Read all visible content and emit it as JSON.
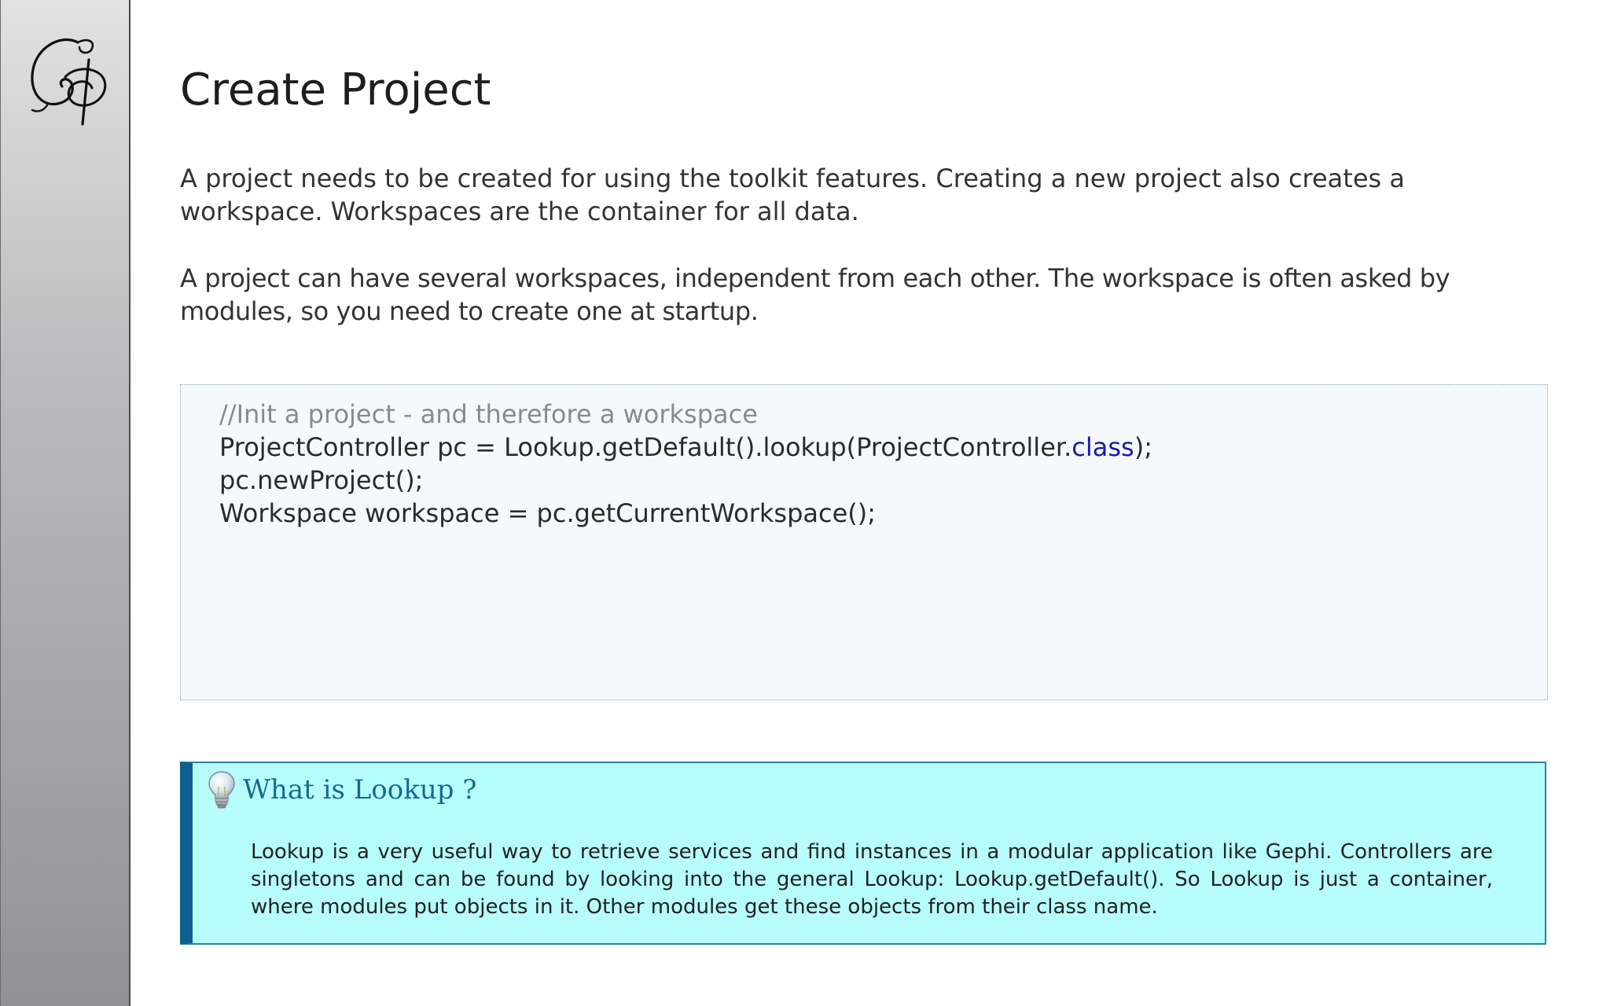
{
  "slide": {
    "title": "Create Project",
    "paragraphs": [
      "A project needs to be created for using the toolkit features. Creating a new project also creates a workspace. Workspaces are the container for all data.",
      "A project can have several workspaces, independent from each other.  The workspace is often asked by modules, so you need to create one at startup."
    ]
  },
  "code": {
    "comment": "//Init a project - and therefore a workspace",
    "line1_before": "ProjectController pc = Lookup.getDefault().lookup(ProjectController.",
    "line1_keyword": "class",
    "line1_after": ");",
    "line2": "pc.newProject();",
    "line3": "Workspace workspace = pc.getCurrentWorkspace();"
  },
  "callout": {
    "icon": "lightbulb-icon",
    "title": "What is Lookup ?",
    "body": "Lookup is a very useful way to retrieve services and find instances in a modular application like Gephi. Controllers are singletons and can be found by looking into the general Lookup: Lookup.getDefault(). So Lookup is just a container, where modules put objects in it. Other modules get these objects from their class name."
  },
  "colors": {
    "callout_background": "#b7fdfc",
    "callout_accent": "#0d5f8d",
    "callout_title": "#146a93",
    "code_keyword": "#1a1aa6",
    "code_comment": "#8a8a8a"
  }
}
